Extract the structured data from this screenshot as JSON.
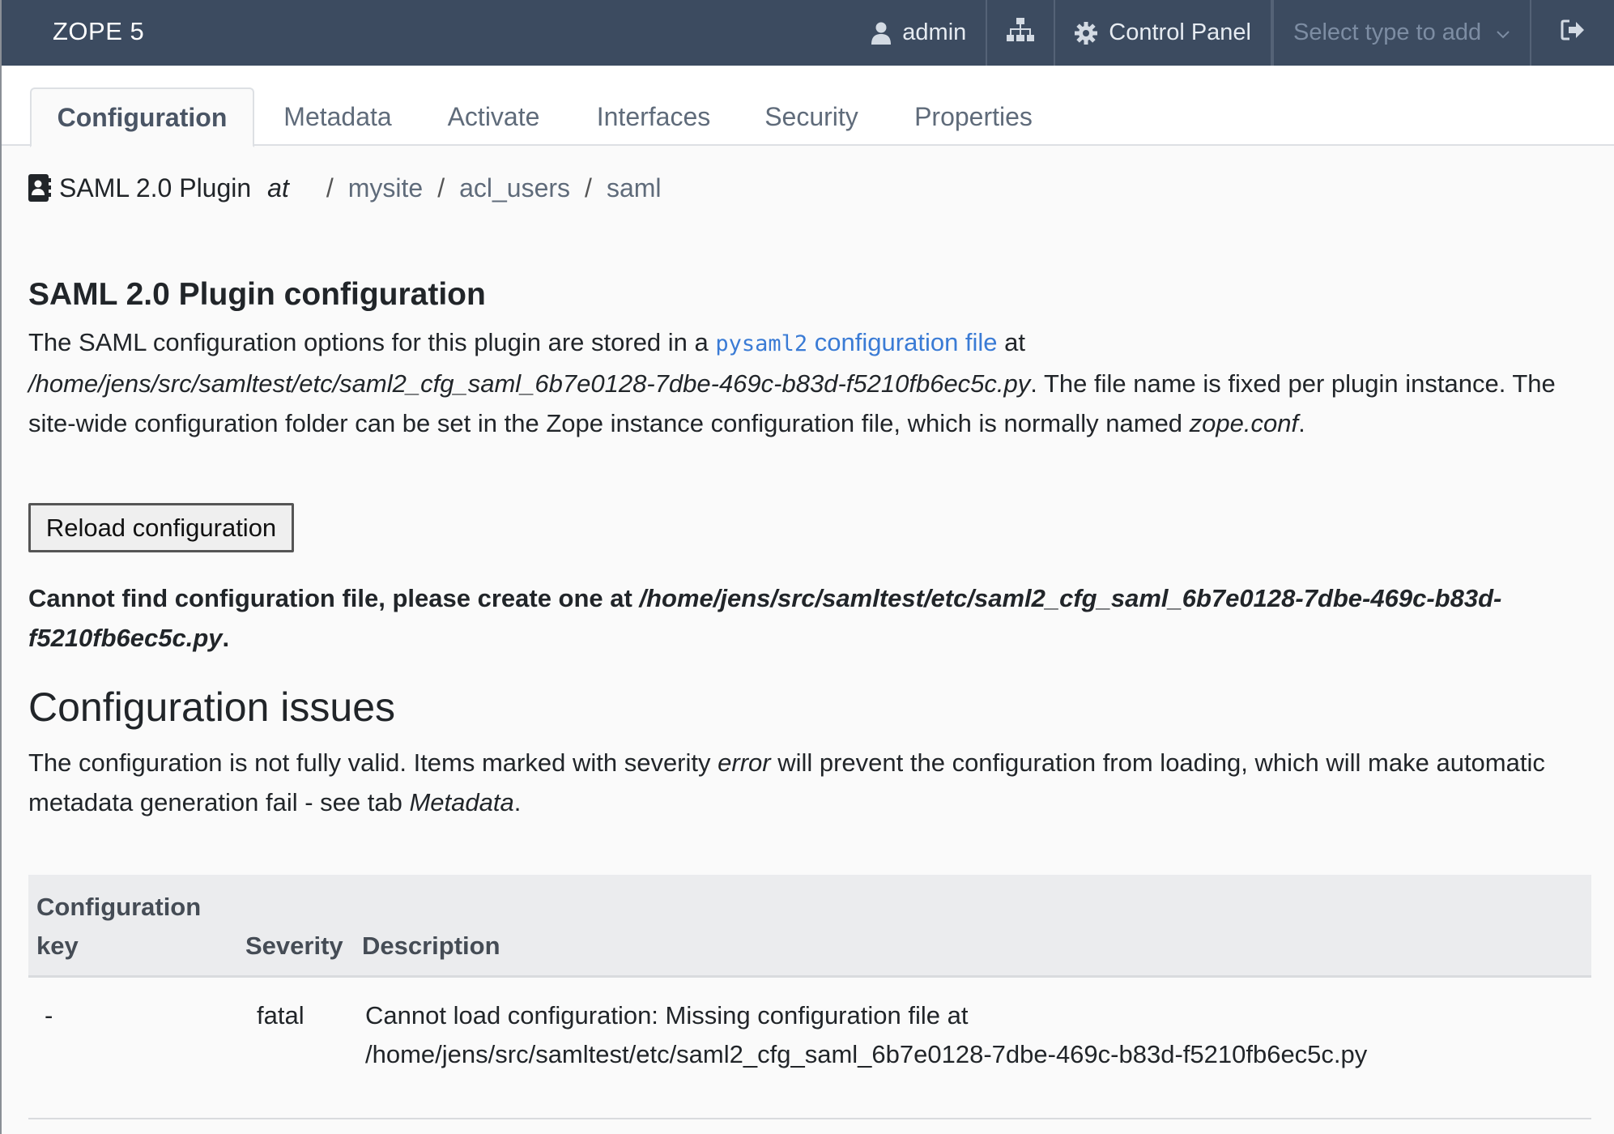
{
  "navbar": {
    "brand": "ZOPE 5",
    "user": "admin",
    "control_panel": "Control Panel",
    "add_select_placeholder": "Select type to add"
  },
  "tabs": [
    {
      "label": "Configuration",
      "active": true
    },
    {
      "label": "Metadata",
      "active": false
    },
    {
      "label": "Activate",
      "active": false
    },
    {
      "label": "Interfaces",
      "active": false
    },
    {
      "label": "Security",
      "active": false
    },
    {
      "label": "Properties",
      "active": false
    }
  ],
  "breadcrumb": {
    "object_title": "SAML 2.0 Plugin",
    "at": "at",
    "separator": "/",
    "path": [
      "mysite",
      "acl_users",
      "saml"
    ]
  },
  "config": {
    "heading": "SAML 2.0 Plugin configuration",
    "intro_prefix": "The SAML configuration options for this plugin are stored in a ",
    "intro_code_link": "pysaml2",
    "intro_link_text": " configuration file",
    "intro_at": " at",
    "config_path": "/home/jens/src/samltest/etc/saml2_cfg_saml_6b7e0128-7dbe-469c-b83d-f5210fb6ec5c.py",
    "intro_fixed": ". The file name is fixed per plugin instance. The site-wide configuration folder can be set in the Zope instance configuration file, which is normally named ",
    "zope_conf": "zope.conf",
    "intro_end": ".",
    "reload_button": "Reload configuration",
    "error_prefix": "Cannot find configuration file, please create one at ",
    "error_path": "/home/jens/src/samltest/etc/saml2_cfg_saml_6b7e0128-7dbe-469c-b83d-f5210fb6ec5c.py",
    "error_end": "."
  },
  "issues": {
    "heading": "Configuration issues",
    "text_prefix": "The configuration is not fully valid. Items marked with severity ",
    "text_error": "error",
    "text_middle": " will prevent the configuration from loading, which will make automatic metadata generation fail - see tab ",
    "text_metadata": "Metadata",
    "text_end": ".",
    "columns": [
      "Configuration key",
      "Severity",
      "Description"
    ],
    "rows": [
      {
        "key": "-",
        "severity": "fatal",
        "description_line1": "Cannot load configuration: Missing configuration file at",
        "description_line2": "/home/jens/src/samltest/etc/saml2_cfg_saml_6b7e0128-7dbe-469c-b83d-f5210fb6ec5c.py"
      }
    ]
  },
  "colors": {
    "navbar_bg": "#3c4b60",
    "link": "#3a7bd5",
    "table_header_bg": "#ebecee"
  }
}
